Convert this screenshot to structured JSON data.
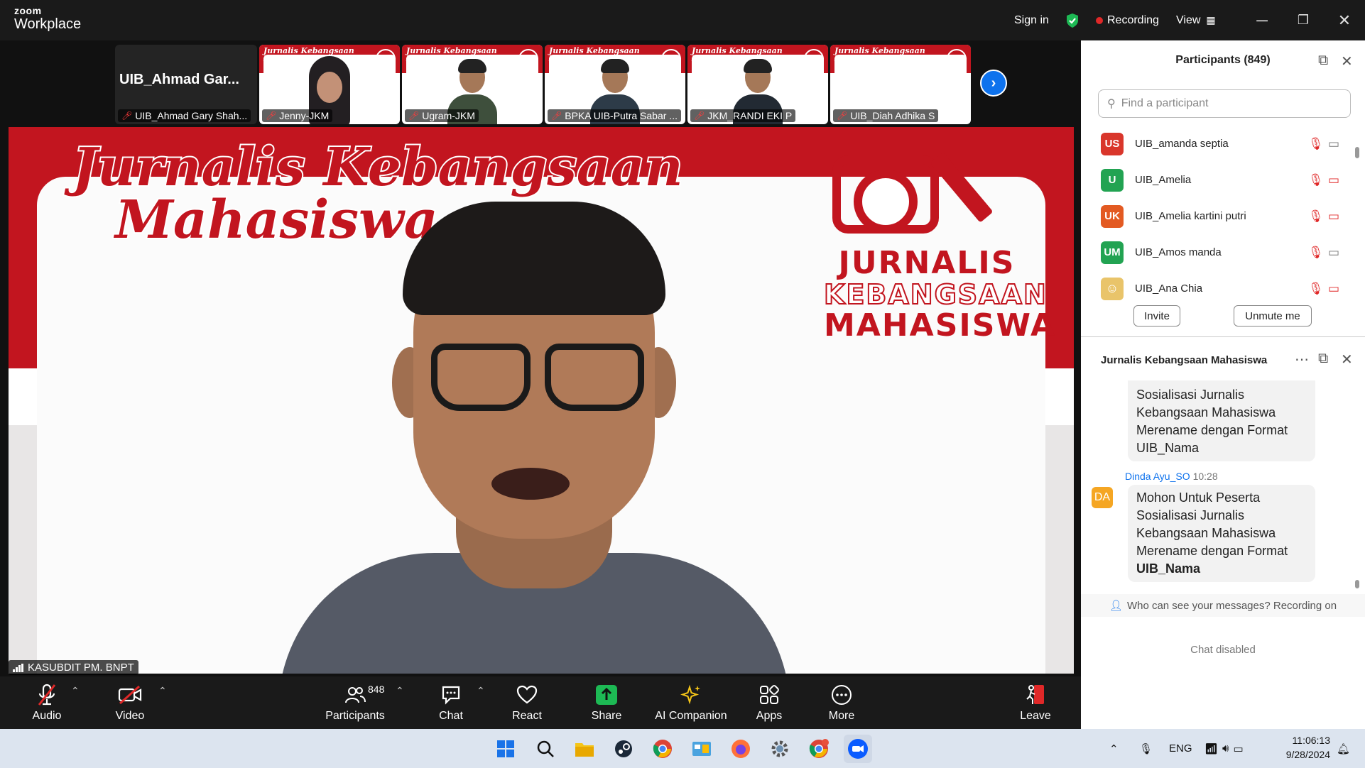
{
  "titlebar": {
    "brand_small": "zoom",
    "brand_large": "Workplace",
    "sign_in": "Sign in",
    "recording": "Recording",
    "view": "View"
  },
  "strip": {
    "self_title": "UIB_Ahmad  Gar...",
    "self_name": "UIB_Ahmad Gary Shah...",
    "tiles": [
      {
        "name": "Jenny-JKM",
        "banner": "Jurnalis Kebangsaan Mahasiswa"
      },
      {
        "name": "Ugram-JKM",
        "banner": "Jurnalis Kebangsaan Mahasiswa"
      },
      {
        "name": "BPKA UIB-Putra Sabar ...",
        "banner": "Jurnalis Kebangsaan Mahasiswa"
      },
      {
        "name": "JKM_RANDI EKI P",
        "banner": "Jurnalis Kebangsaan Mahasiswa"
      },
      {
        "name": "UIB_Diah Adhika S",
        "banner": "Jurnalis Kebangsaan Mahasiswa"
      }
    ]
  },
  "stage": {
    "title_line1": "Jurnalis Kebangsaan",
    "title_line2": "Mahasiswa",
    "logo_line1": "JURNALIS",
    "logo_line2": "KEBANGSAAN",
    "logo_line3": "MAHASISWA",
    "speaker_name": "KASUBDIT PM. BNPT"
  },
  "toolbar": {
    "audio": "Audio",
    "video": "Video",
    "participants": "Participants",
    "participants_count": "848",
    "chat": "Chat",
    "react": "React",
    "share": "Share",
    "ai": "AI Companion",
    "apps": "Apps",
    "more": "More",
    "leave": "Leave"
  },
  "participants": {
    "title": "Participants (849)",
    "search_placeholder": "Find a participant",
    "list": [
      {
        "initials": "US",
        "name": "UIB_amanda septia",
        "color": "#d9362b",
        "video_off": false
      },
      {
        "initials": "U",
        "name": "UIB_Amelia",
        "color": "#22a352",
        "video_off": true
      },
      {
        "initials": "UK",
        "name": "UIB_Amelia kartini putri",
        "color": "#e35a22",
        "video_off": true
      },
      {
        "initials": "UM",
        "name": "UIB_Amos manda",
        "color": "#22a352",
        "video_off": false
      },
      {
        "initials": "",
        "name": "UIB_Ana Chia",
        "color": "#e9c46a",
        "video_off": true
      }
    ],
    "invite": "Invite",
    "unmute": "Unmute me"
  },
  "chat": {
    "title": "Jurnalis Kebangsaan Mahasiswa",
    "msg1": [
      "Sosialisasi Jurnalis",
      "Kebangsaan Mahasiswa",
      "Merename dengan Format",
      "UIB_Nama"
    ],
    "sender": "Dinda Ayu_SO",
    "sender_initials": "DA",
    "time": "10:28",
    "msg2": [
      "Mohon Untuk Peserta",
      "Sosialisasi Jurnalis",
      "Kebangsaan Mahasiswa",
      "Merename dengan Format",
      "UIB_Nama"
    ],
    "who_can_see": "Who can see your messages? Recording on",
    "disabled": "Chat disabled"
  },
  "taskbar": {
    "lang": "ENG",
    "time": "11:06:13",
    "date": "9/28/2024"
  }
}
